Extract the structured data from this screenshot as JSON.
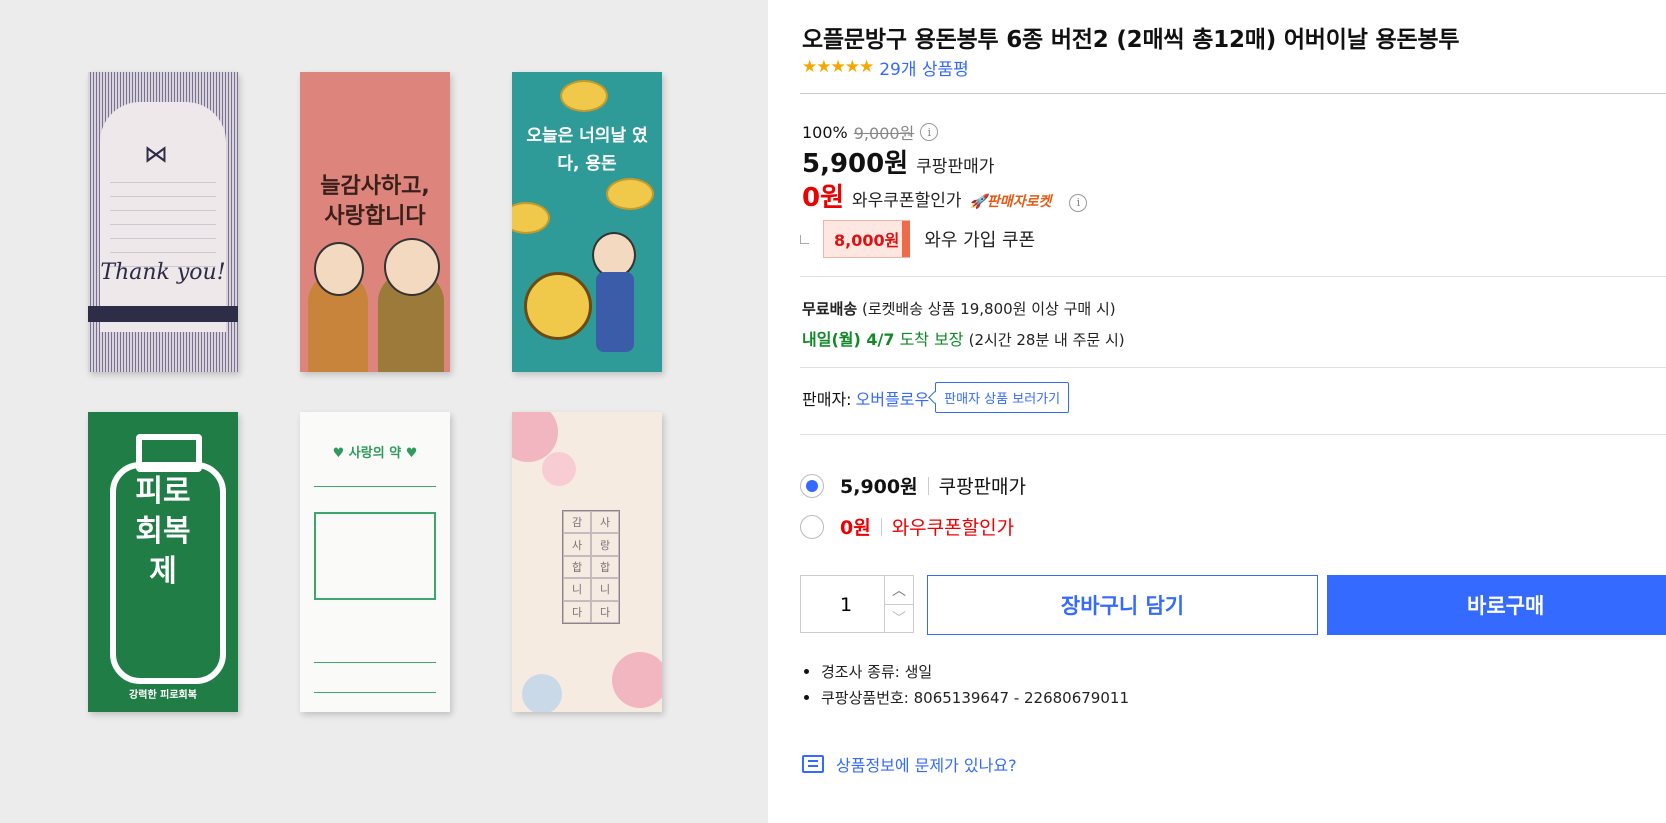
{
  "product": {
    "title": "오플문방구 용돈봉투 6종 버전2 (2매씩 총12매) 어버이날 용돈봉투",
    "stars": "★★★★★",
    "review_text": "29개 상품평",
    "discount_rate": "100%",
    "original_price": "9,000원",
    "sale_price": "5,900원",
    "sale_label": "쿠팡판매가",
    "wow_price": "0원",
    "wow_label": "와우쿠폰할인가",
    "seller_rocket": "🚀판매자로켓",
    "coupon_amount": "8,000원",
    "coupon_label": "와우 가입 쿠폰"
  },
  "shipping": {
    "free_label": "무료배송",
    "free_condition": "(로켓배송 상품 19,800원 이상 구매 시)",
    "arrival_day": "내일(월) 4/7",
    "arrival_label": "도착 보장",
    "arrival_condition": "(2시간 28분 내 주문 시)"
  },
  "seller": {
    "label": "판매자:",
    "name": "오버플로우",
    "view_button": "판매자 상품 보러가기"
  },
  "options": [
    {
      "price": "5,900원",
      "label": "쿠팡판매가",
      "selected": true
    },
    {
      "price": "0원",
      "label": "와우쿠폰할인가",
      "selected": false
    }
  ],
  "purchase": {
    "quantity": "1",
    "cart_button": "장바구니 담기",
    "buy_button": "바로구매"
  },
  "details": [
    "경조사 종류: 생일",
    "쿠팡상품번호: 8065139647 - 22680679011"
  ],
  "report_link": "상품정보에 문제가 있나요?",
  "images": {
    "card1_text": "Thank you!",
    "card2_text": "늘감사하고, 사랑합니다",
    "card3_text": "오늘은 너의날 였다, 용돈",
    "card4_text": "피로회복제",
    "card4_sub": "강력한 피로회복",
    "card5_title": "♥ 사랑의 약 ♥",
    "card6_chars": [
      "감",
      "사",
      "사",
      "랑",
      "합",
      "합",
      "니",
      "니",
      "다",
      "다"
    ]
  },
  "colors": {
    "accent": "#346aff",
    "price_red": "#e00000",
    "arrival_green": "#108a27",
    "star": "#f7a600"
  }
}
